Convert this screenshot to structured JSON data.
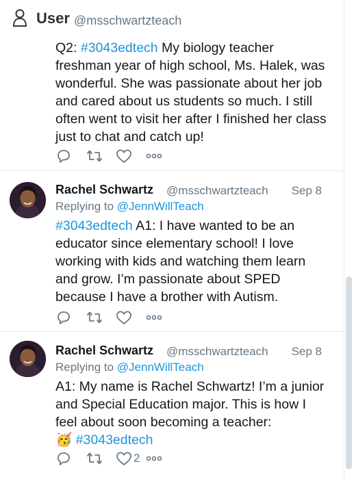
{
  "header": {
    "title": "User",
    "handle": "@msschwartzteach",
    "icon": "user-icon"
  },
  "tweets": [
    {
      "text_prefix": "Q2: ",
      "hashtag": "#3043edtech",
      "text_rest": " My biology teacher freshman year of high school, Ms. Halek, was wonderful. She was passionate about her job and cared about us students so much. I still often went to visit her after I finished her class just to chat and catch up!",
      "likes": ""
    },
    {
      "name": "Rachel Schwartz",
      "handle": "@msschwartzteach",
      "date": "Sep 8",
      "replying_prefix": "Replying to ",
      "replying_to": "@JennWillTeach",
      "hashtag": "#3043edtech",
      "text_rest": " A1: I have wanted to be an educator since elementary school! I love working with kids and watching them learn and grow. I’m passionate about SPED because I have a brother with Autism.",
      "likes": ""
    },
    {
      "name": "Rachel Schwartz",
      "handle": "@msschwartzteach",
      "date": "Sep 8",
      "replying_prefix": "Replying to ",
      "replying_to": "@JennWillTeach",
      "text_body": "A1: My name is Rachel Schwartz! I’m a junior and Special Education major. This is how I feel about soon becoming a teacher:",
      "emoji": "🥳",
      "hashtag": "#3043edtech",
      "likes": "2"
    }
  ],
  "colors": {
    "link": "#1b95e0",
    "muted": "#657786",
    "text": "#14171a",
    "divider": "#e6ecf0"
  }
}
